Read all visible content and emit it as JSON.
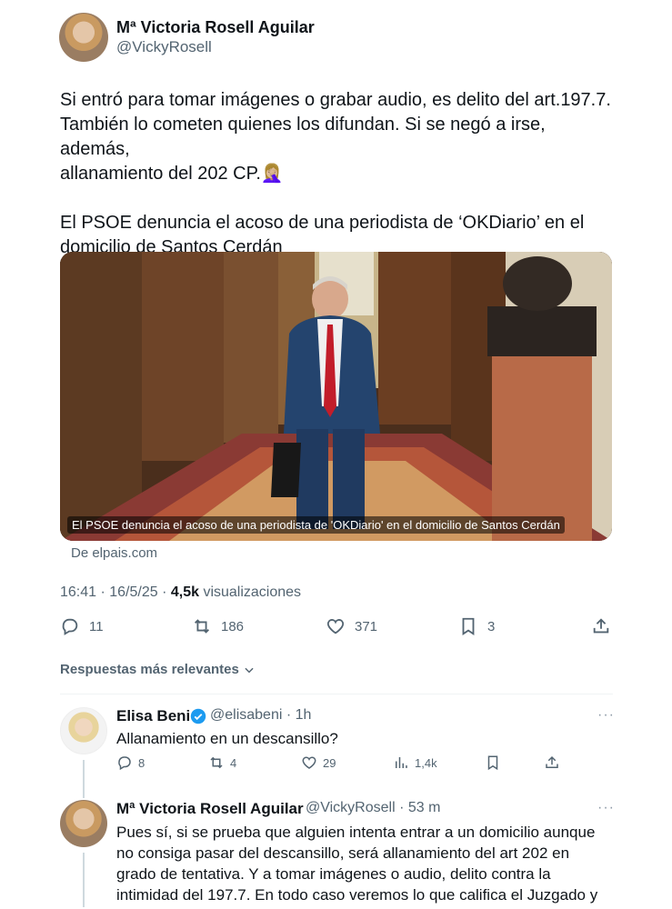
{
  "tweet": {
    "author_name": "Mª Victoria Rosell Aguilar",
    "author_handle": "@VickyRosell",
    "text_line1": "Si entró para tomar imágenes o grabar audio, es delito del art.197.7.",
    "text_line2": "También lo cometen quienes los difundan. Si se negó a irse, además,",
    "text_line3": "allanamiento del 202 CP.🤦🏼‍♀️",
    "text_line4": "El PSOE denuncia el acoso de una periodista de ‘OKDiario’ en el",
    "text_line5": "domicilio de Santos Cerdán",
    "media_caption": "El PSOE denuncia el acoso de una periodista de 'OKDiario' en el domicilio de Santos Cerdán",
    "link_source": "De elpais.com",
    "time": "16:41 · 16/5/25 · ",
    "views_count": "4,5k",
    "views_label": " visualizaciones",
    "actions": {
      "replies": "11",
      "retweets": "186",
      "likes": "371",
      "bookmarks": "3"
    }
  },
  "replies_header": "Respuestas más relevantes",
  "replies": [
    {
      "name": "Elisa Beni",
      "handle": "@elisabeni · 1h",
      "text": "Allanamiento en un descansillo?",
      "replies": "8",
      "retweets": "4",
      "likes": "29",
      "views": "1,4k"
    },
    {
      "name": "Mª Victoria Rosell Aguilar",
      "handle": "@VickyRosell · 53 m",
      "line1": "Pues sí, si se prueba que alguien intenta entrar a un domicilio aunque",
      "line2": "no consiga pasar del descansillo, será allanamiento del art 202 en",
      "line3": "grado de tentativa. Y a tomar imágenes o audio, delito contra la",
      "line4": "intimidad del 197.7. En todo caso veremos lo que califica el Juzgado y"
    }
  ],
  "more_glyph": "···",
  "icons": {
    "reply": "reply-icon",
    "retweet": "retweet-icon",
    "like": "heart-icon",
    "bookmark": "bookmark-icon",
    "share": "share-icon",
    "views": "views-icon",
    "verified": "verified-badge-icon"
  }
}
